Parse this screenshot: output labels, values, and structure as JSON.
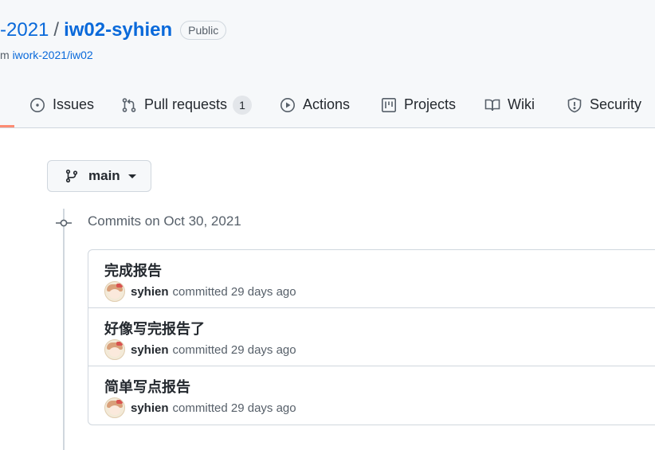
{
  "repo": {
    "owner_fragment": "-2021",
    "separator": "/",
    "name": "iw02-syhien",
    "visibility": "Public",
    "fork_prefix": "m",
    "fork_source": "iwork-2021/iw02"
  },
  "tabs": [
    {
      "label": "Issues",
      "icon": "issue-opened-icon"
    },
    {
      "label": "Pull requests",
      "icon": "git-pull-request-icon",
      "count": "1"
    },
    {
      "label": "Actions",
      "icon": "play-icon"
    },
    {
      "label": "Projects",
      "icon": "project-icon"
    },
    {
      "label": "Wiki",
      "icon": "book-icon"
    },
    {
      "label": "Security",
      "icon": "shield-icon"
    }
  ],
  "branch": {
    "name": "main",
    "icon": "git-branch-icon"
  },
  "commits_header": "Commits on Oct 30, 2021",
  "commits": [
    {
      "message": "完成报告",
      "author": "syhien",
      "action": "committed",
      "time": "29 days ago"
    },
    {
      "message": "好像写完报告了",
      "author": "syhien",
      "action": "committed",
      "time": "29 days ago"
    },
    {
      "message": "简单写点报告",
      "author": "syhien",
      "action": "committed",
      "time": "29 days ago"
    }
  ],
  "colors": {
    "link": "#0969da",
    "muted": "#57606a",
    "border": "#d0d7de",
    "header_bg": "#f6f8fa",
    "active_tab_underline": "#fd8c73"
  }
}
